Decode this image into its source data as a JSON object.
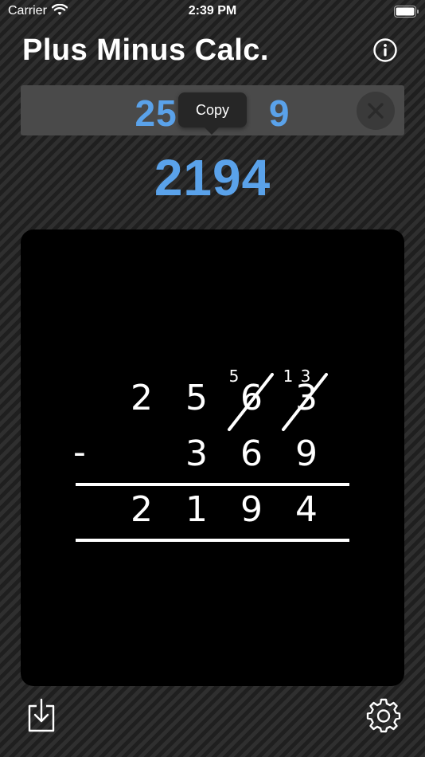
{
  "status_bar": {
    "carrier": "Carrier",
    "time": "2:39 PM",
    "icons": [
      "wifi-icon",
      "battery-icon"
    ]
  },
  "header": {
    "title": "Plus Minus Calc.",
    "info_icon": "info-icon"
  },
  "input": {
    "expression": "2563-369",
    "expression_visible_left": "2563",
    "expression_visible_right": "9",
    "clear_icon": "close-icon"
  },
  "popup": {
    "label": "Copy"
  },
  "result": {
    "value": "2194"
  },
  "work": {
    "minuend_digits": [
      "2",
      "5",
      "6",
      "3"
    ],
    "borrow_marks": [
      "5",
      "1",
      "3"
    ],
    "operator": "-",
    "subtrahend_digits": [
      "3",
      "6",
      "9"
    ],
    "result_digits": [
      "2",
      "1",
      "9",
      "4"
    ]
  },
  "toolbar": {
    "save_icon": "save-icon",
    "settings_icon": "gear-icon"
  },
  "colors": {
    "accent": "#5aa2ea",
    "panel": "#000000",
    "input_bg": "#4a4a4a",
    "popup_bg": "#262626"
  }
}
